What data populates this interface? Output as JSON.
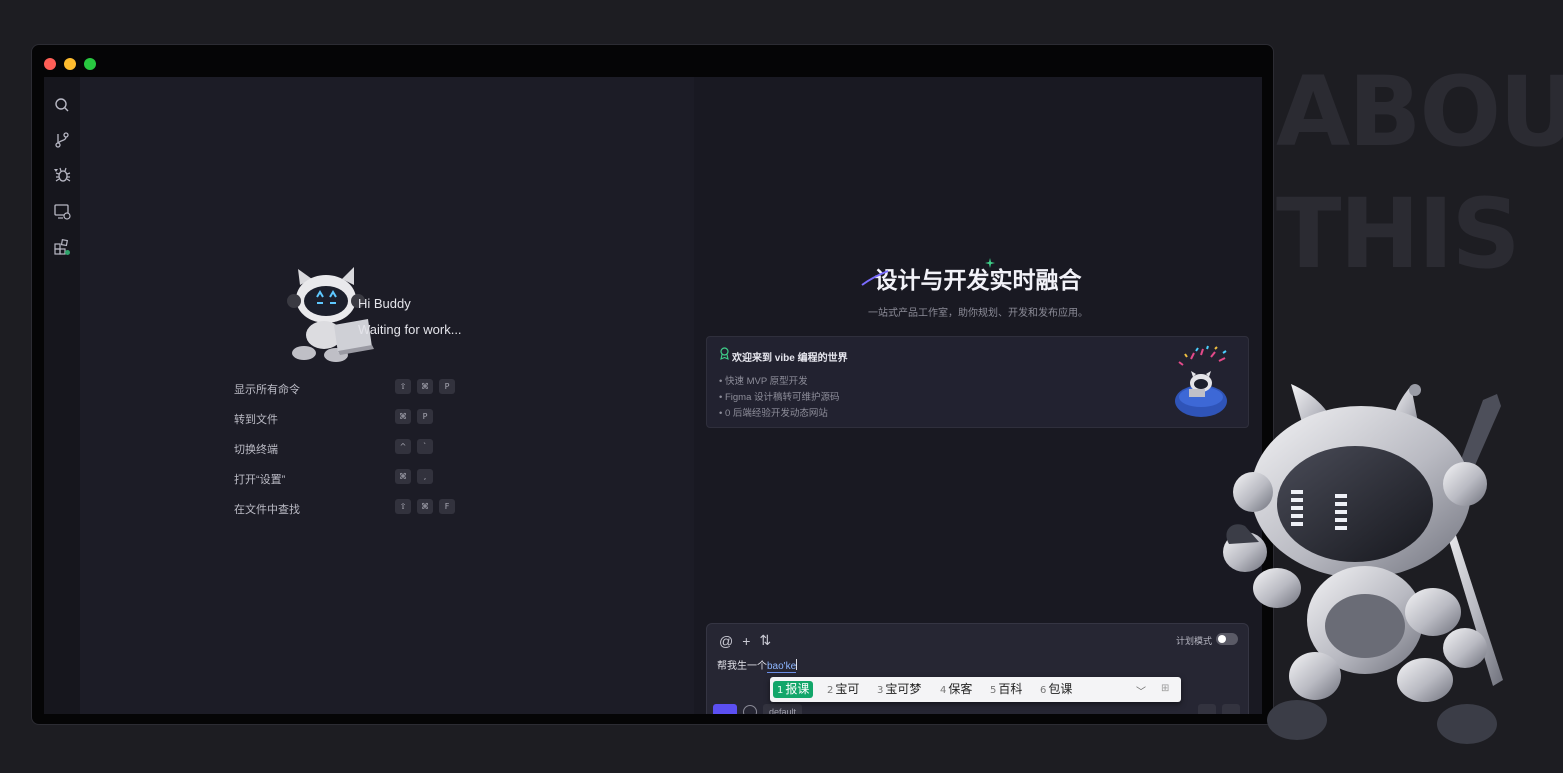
{
  "background": {
    "words": [
      "ABOU",
      "THIS"
    ]
  },
  "sidebar": {
    "icons": [
      "search-icon",
      "source-control-icon",
      "debug-icon",
      "remote-explorer-icon",
      "extensions-icon"
    ]
  },
  "welcome": {
    "greeting": "Hi Buddy",
    "status": "Waiting for work...",
    "commands": [
      {
        "label": "显示所有命令",
        "keys": [
          "⇧",
          "⌘",
          "P"
        ]
      },
      {
        "label": "转到文件",
        "keys": [
          "⌘",
          "P"
        ]
      },
      {
        "label": "切换终端",
        "keys": [
          "^",
          "`"
        ]
      },
      {
        "label": "打开“设置”",
        "keys": [
          "⌘",
          ","
        ]
      },
      {
        "label": "在文件中查找",
        "keys": [
          "⇧",
          "⌘",
          "F"
        ]
      }
    ]
  },
  "hero": {
    "title": "设计与开发实时融合",
    "subtitle": "一站式产品工作室，助你规划、开发和发布应用。"
  },
  "intro_card": {
    "title": "欢迎来到 vibe 编程的世界",
    "bullets": [
      "快速 MVP 原型开发",
      "Figma 设计稿转可维护源码",
      "0 后端经验开发动态网站"
    ]
  },
  "chat": {
    "tools": [
      "@",
      "+",
      "⇅"
    ],
    "plan_mode_label": "计划模式",
    "plan_mode_on": false,
    "input_prefix": "帮我生一个",
    "input_composing": "bao'ke",
    "model_label": "default"
  },
  "ime": {
    "candidates": [
      {
        "num": "1",
        "text": "报课"
      },
      {
        "num": "2",
        "text": "宝可"
      },
      {
        "num": "3",
        "text": "宝可梦"
      },
      {
        "num": "4",
        "text": "保客"
      },
      {
        "num": "5",
        "text": "百科"
      },
      {
        "num": "6",
        "text": "包课"
      }
    ],
    "selected_index": 0,
    "accent": "#12a66a"
  },
  "colors": {
    "window_traffic": [
      "#ff5f57",
      "#febc2e",
      "#28c840"
    ],
    "accent_purple": "#5b4ff2"
  }
}
